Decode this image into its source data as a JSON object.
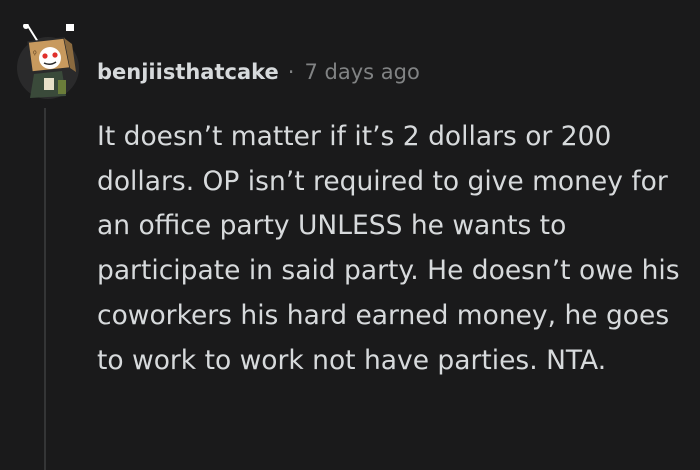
{
  "comment": {
    "author": "benjiisthatcake",
    "separator": "·",
    "age": "7 days ago",
    "body": "It doesn’t matter if it’s 2 dollars or 200 dollars. OP isn’t required to give money for an office party UNLESS he wants to participate in said party. He doesn’t owe his coworkers his hard earned money, he goes to work to work not have parties. NTA."
  },
  "avatar": {
    "icon": "snoo-box-robot-avatar",
    "colors": {
      "box": "#c89a5e",
      "box_dark": "#8a6a3f",
      "face": "#ffffff",
      "accent": "#e0302c",
      "antenna": "#ffffff",
      "body": "#3a4a3a"
    }
  },
  "theme": {
    "background": "#1a1a1b",
    "text": "#d7dadc",
    "meta": "#818384",
    "thread_line": "#343536"
  }
}
